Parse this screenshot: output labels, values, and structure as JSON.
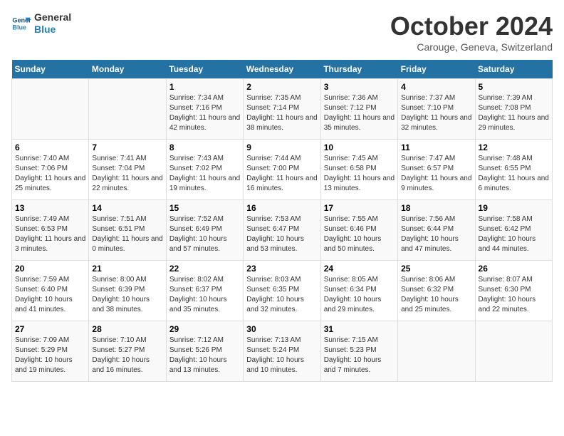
{
  "header": {
    "logo_line1": "General",
    "logo_line2": "Blue",
    "month": "October 2024",
    "location": "Carouge, Geneva, Switzerland"
  },
  "weekdays": [
    "Sunday",
    "Monday",
    "Tuesday",
    "Wednesday",
    "Thursday",
    "Friday",
    "Saturday"
  ],
  "weeks": [
    [
      {
        "day": "",
        "sunrise": "",
        "sunset": "",
        "daylight": ""
      },
      {
        "day": "",
        "sunrise": "",
        "sunset": "",
        "daylight": ""
      },
      {
        "day": "1",
        "sunrise": "Sunrise: 7:34 AM",
        "sunset": "Sunset: 7:16 PM",
        "daylight": "Daylight: 11 hours and 42 minutes."
      },
      {
        "day": "2",
        "sunrise": "Sunrise: 7:35 AM",
        "sunset": "Sunset: 7:14 PM",
        "daylight": "Daylight: 11 hours and 38 minutes."
      },
      {
        "day": "3",
        "sunrise": "Sunrise: 7:36 AM",
        "sunset": "Sunset: 7:12 PM",
        "daylight": "Daylight: 11 hours and 35 minutes."
      },
      {
        "day": "4",
        "sunrise": "Sunrise: 7:37 AM",
        "sunset": "Sunset: 7:10 PM",
        "daylight": "Daylight: 11 hours and 32 minutes."
      },
      {
        "day": "5",
        "sunrise": "Sunrise: 7:39 AM",
        "sunset": "Sunset: 7:08 PM",
        "daylight": "Daylight: 11 hours and 29 minutes."
      }
    ],
    [
      {
        "day": "6",
        "sunrise": "Sunrise: 7:40 AM",
        "sunset": "Sunset: 7:06 PM",
        "daylight": "Daylight: 11 hours and 25 minutes."
      },
      {
        "day": "7",
        "sunrise": "Sunrise: 7:41 AM",
        "sunset": "Sunset: 7:04 PM",
        "daylight": "Daylight: 11 hours and 22 minutes."
      },
      {
        "day": "8",
        "sunrise": "Sunrise: 7:43 AM",
        "sunset": "Sunset: 7:02 PM",
        "daylight": "Daylight: 11 hours and 19 minutes."
      },
      {
        "day": "9",
        "sunrise": "Sunrise: 7:44 AM",
        "sunset": "Sunset: 7:00 PM",
        "daylight": "Daylight: 11 hours and 16 minutes."
      },
      {
        "day": "10",
        "sunrise": "Sunrise: 7:45 AM",
        "sunset": "Sunset: 6:58 PM",
        "daylight": "Daylight: 11 hours and 13 minutes."
      },
      {
        "day": "11",
        "sunrise": "Sunrise: 7:47 AM",
        "sunset": "Sunset: 6:57 PM",
        "daylight": "Daylight: 11 hours and 9 minutes."
      },
      {
        "day": "12",
        "sunrise": "Sunrise: 7:48 AM",
        "sunset": "Sunset: 6:55 PM",
        "daylight": "Daylight: 11 hours and 6 minutes."
      }
    ],
    [
      {
        "day": "13",
        "sunrise": "Sunrise: 7:49 AM",
        "sunset": "Sunset: 6:53 PM",
        "daylight": "Daylight: 11 hours and 3 minutes."
      },
      {
        "day": "14",
        "sunrise": "Sunrise: 7:51 AM",
        "sunset": "Sunset: 6:51 PM",
        "daylight": "Daylight: 11 hours and 0 minutes."
      },
      {
        "day": "15",
        "sunrise": "Sunrise: 7:52 AM",
        "sunset": "Sunset: 6:49 PM",
        "daylight": "Daylight: 10 hours and 57 minutes."
      },
      {
        "day": "16",
        "sunrise": "Sunrise: 7:53 AM",
        "sunset": "Sunset: 6:47 PM",
        "daylight": "Daylight: 10 hours and 53 minutes."
      },
      {
        "day": "17",
        "sunrise": "Sunrise: 7:55 AM",
        "sunset": "Sunset: 6:46 PM",
        "daylight": "Daylight: 10 hours and 50 minutes."
      },
      {
        "day": "18",
        "sunrise": "Sunrise: 7:56 AM",
        "sunset": "Sunset: 6:44 PM",
        "daylight": "Daylight: 10 hours and 47 minutes."
      },
      {
        "day": "19",
        "sunrise": "Sunrise: 7:58 AM",
        "sunset": "Sunset: 6:42 PM",
        "daylight": "Daylight: 10 hours and 44 minutes."
      }
    ],
    [
      {
        "day": "20",
        "sunrise": "Sunrise: 7:59 AM",
        "sunset": "Sunset: 6:40 PM",
        "daylight": "Daylight: 10 hours and 41 minutes."
      },
      {
        "day": "21",
        "sunrise": "Sunrise: 8:00 AM",
        "sunset": "Sunset: 6:39 PM",
        "daylight": "Daylight: 10 hours and 38 minutes."
      },
      {
        "day": "22",
        "sunrise": "Sunrise: 8:02 AM",
        "sunset": "Sunset: 6:37 PM",
        "daylight": "Daylight: 10 hours and 35 minutes."
      },
      {
        "day": "23",
        "sunrise": "Sunrise: 8:03 AM",
        "sunset": "Sunset: 6:35 PM",
        "daylight": "Daylight: 10 hours and 32 minutes."
      },
      {
        "day": "24",
        "sunrise": "Sunrise: 8:05 AM",
        "sunset": "Sunset: 6:34 PM",
        "daylight": "Daylight: 10 hours and 29 minutes."
      },
      {
        "day": "25",
        "sunrise": "Sunrise: 8:06 AM",
        "sunset": "Sunset: 6:32 PM",
        "daylight": "Daylight: 10 hours and 25 minutes."
      },
      {
        "day": "26",
        "sunrise": "Sunrise: 8:07 AM",
        "sunset": "Sunset: 6:30 PM",
        "daylight": "Daylight: 10 hours and 22 minutes."
      }
    ],
    [
      {
        "day": "27",
        "sunrise": "Sunrise: 7:09 AM",
        "sunset": "Sunset: 5:29 PM",
        "daylight": "Daylight: 10 hours and 19 minutes."
      },
      {
        "day": "28",
        "sunrise": "Sunrise: 7:10 AM",
        "sunset": "Sunset: 5:27 PM",
        "daylight": "Daylight: 10 hours and 16 minutes."
      },
      {
        "day": "29",
        "sunrise": "Sunrise: 7:12 AM",
        "sunset": "Sunset: 5:26 PM",
        "daylight": "Daylight: 10 hours and 13 minutes."
      },
      {
        "day": "30",
        "sunrise": "Sunrise: 7:13 AM",
        "sunset": "Sunset: 5:24 PM",
        "daylight": "Daylight: 10 hours and 10 minutes."
      },
      {
        "day": "31",
        "sunrise": "Sunrise: 7:15 AM",
        "sunset": "Sunset: 5:23 PM",
        "daylight": "Daylight: 10 hours and 7 minutes."
      },
      {
        "day": "",
        "sunrise": "",
        "sunset": "",
        "daylight": ""
      },
      {
        "day": "",
        "sunrise": "",
        "sunset": "",
        "daylight": ""
      }
    ]
  ]
}
